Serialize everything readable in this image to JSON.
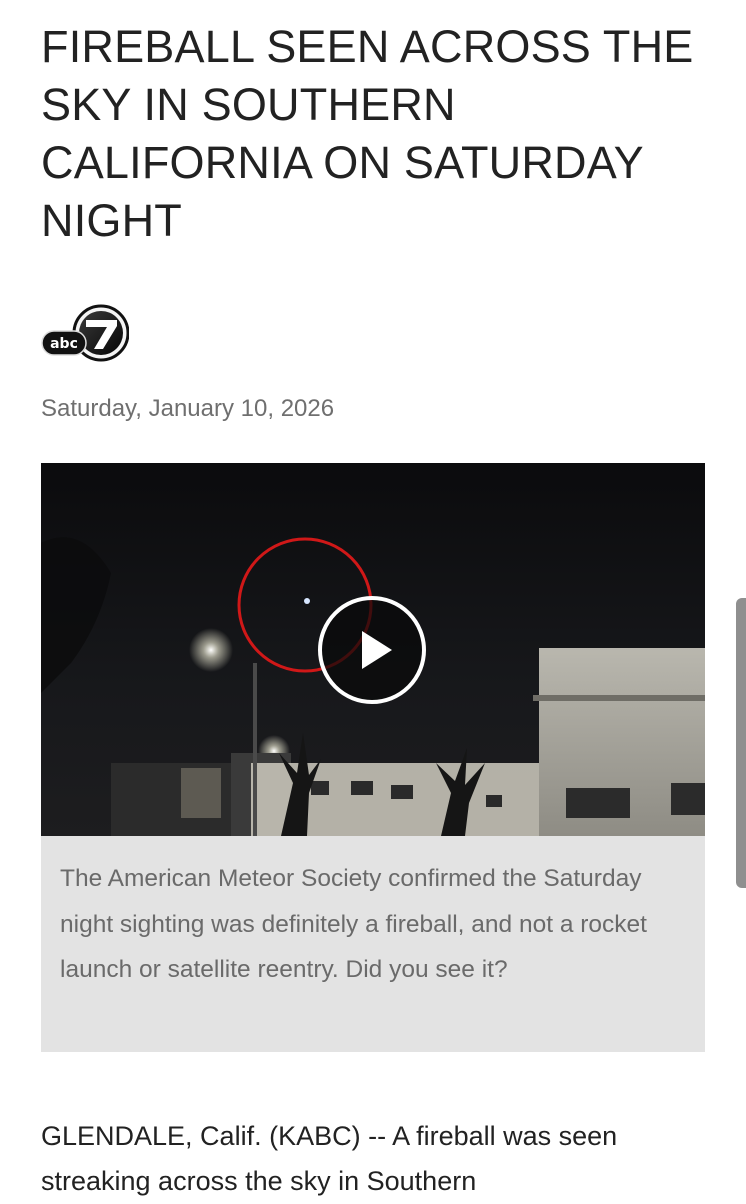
{
  "article": {
    "headline": "FIREBALL SEEN ACROSS THE SKY IN SOUTHERN CALIFORNIA ON SATURDAY NIGHT",
    "logo_alt": "abc7",
    "date": "Saturday, January 10, 2026",
    "video": {
      "caption": "The American Meteor Society confirmed the Saturday night sighting was definitely a fireball, and not a rocket launch or satellite reentry. Did you see it?"
    },
    "body_first_paragraph": "GLENDALE, Calif. (KABC) -- A fireball was seen streaking across the sky in Southern"
  },
  "icons": {
    "logo": "abc7-logo",
    "play": "play-icon"
  },
  "colors": {
    "caption_background": "#e3e3e3",
    "circle_annotation": "#d01818",
    "date_text": "#6f6f6f"
  }
}
